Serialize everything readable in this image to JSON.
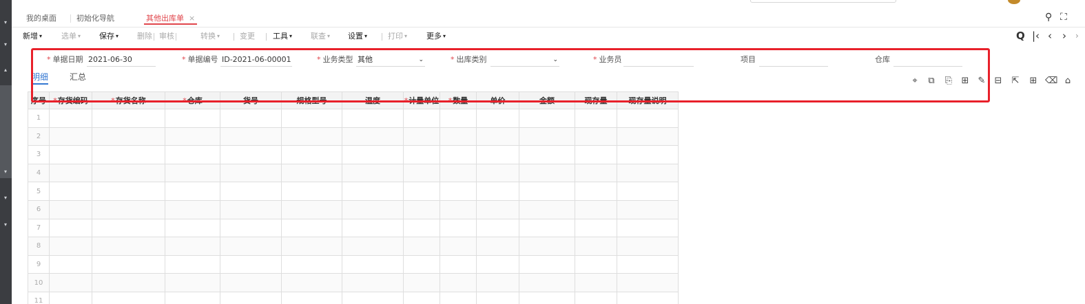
{
  "tabs": [
    {
      "label": "我的桌面"
    },
    {
      "label": "初始化导航"
    },
    {
      "label": "其他出库单",
      "close": "×"
    }
  ],
  "toolbar": {
    "items": [
      {
        "label": "新增",
        "enabled": true
      },
      {
        "label": "选单",
        "enabled": false
      },
      {
        "label": "保存",
        "enabled": true
      },
      {
        "label": "删除",
        "enabled": false
      },
      {
        "label": "审核",
        "enabled": false
      },
      {
        "label": "转换",
        "enabled": false
      },
      {
        "label": "变更",
        "enabled": false
      },
      {
        "label": "工具",
        "enabled": true
      },
      {
        "label": "联查",
        "enabled": false
      },
      {
        "label": "设置",
        "enabled": true
      },
      {
        "label": "打印",
        "enabled": false
      },
      {
        "label": "更多",
        "enabled": true
      }
    ],
    "caret": "▾"
  },
  "form": {
    "doc_date_label": "单据日期",
    "doc_date_value": "2021-06-30",
    "doc_no_label": "单据编号",
    "doc_no_value": "ID-2021-06-00001",
    "biz_type_label": "业务类型",
    "biz_type_value": "其他",
    "out_type_label": "出库类别",
    "out_type_value": "",
    "clerk_label": "业务员",
    "clerk_value": "",
    "project_label": "项目",
    "project_value": "",
    "warehouse_label": "仓库",
    "warehouse_value": "",
    "required_mark": "*"
  },
  "subtabs": {
    "detail": "明细",
    "summary": "汇总"
  },
  "grid": {
    "columns": [
      {
        "label": "序号",
        "required": false
      },
      {
        "label": "存货编码",
        "required": true
      },
      {
        "label": "存货名称",
        "required": true
      },
      {
        "label": "仓库",
        "required": true
      },
      {
        "label": "货号",
        "required": false
      },
      {
        "label": "规格型号",
        "required": false
      },
      {
        "label": "温度",
        "required": false
      },
      {
        "label": "计量单位",
        "required": true
      },
      {
        "label": "数量",
        "required": true
      },
      {
        "label": "单价",
        "required": false
      },
      {
        "label": "金额",
        "required": false
      },
      {
        "label": "现存量",
        "required": false
      },
      {
        "label": "现存量说明",
        "required": false
      }
    ],
    "rows": [
      "1",
      "2",
      "3",
      "4",
      "5",
      "6",
      "7",
      "8",
      "9",
      "10",
      "11"
    ]
  },
  "colors": {
    "accent": "#e0454b",
    "link": "#3478d1",
    "highlight": "#e8202a"
  }
}
